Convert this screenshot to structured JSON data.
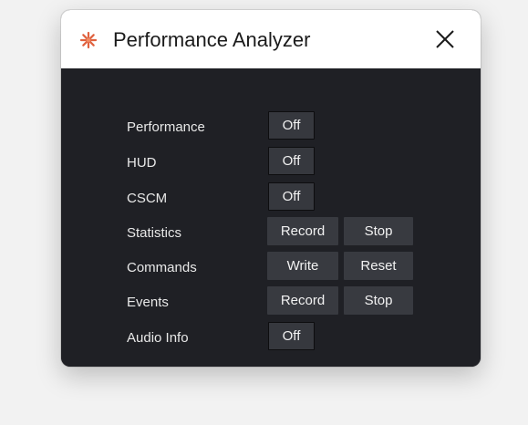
{
  "window": {
    "title": "Performance Analyzer",
    "app_icon": "orange-asterisk-logo-icon",
    "close_icon": "close-icon",
    "accent_color": "#e0623f"
  },
  "rows": [
    {
      "label": "Performance",
      "buttons": [
        "Off"
      ]
    },
    {
      "label": "HUD",
      "buttons": [
        "Off"
      ]
    },
    {
      "label": "CSCM",
      "buttons": [
        "Off"
      ]
    },
    {
      "label": "Statistics",
      "buttons": [
        "Record",
        "Stop"
      ]
    },
    {
      "label": "Commands",
      "buttons": [
        "Write",
        "Reset"
      ]
    },
    {
      "label": "Events",
      "buttons": [
        "Record",
        "Stop"
      ]
    },
    {
      "label": "Audio Info",
      "buttons": [
        "Off"
      ]
    }
  ]
}
